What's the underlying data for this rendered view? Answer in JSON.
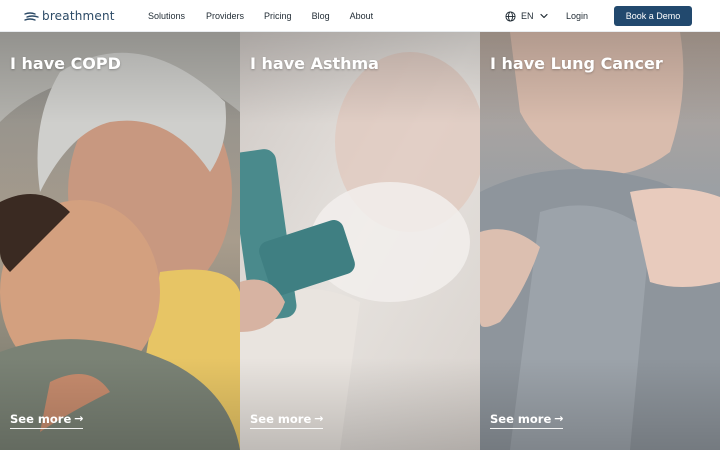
{
  "brand": {
    "name": "breathment",
    "color": "#22496e"
  },
  "nav": {
    "items": [
      {
        "label": "Solutions"
      },
      {
        "label": "Providers"
      },
      {
        "label": "Pricing"
      },
      {
        "label": "Blog"
      },
      {
        "label": "About"
      }
    ]
  },
  "language": {
    "label": "EN",
    "icon": "globe-icon"
  },
  "login": {
    "label": "Login"
  },
  "cta": {
    "label": "Book a Demo",
    "color": "#22496e"
  },
  "cards": [
    {
      "title": "I have COPD",
      "link": "See more"
    },
    {
      "title": "I have Asthma",
      "link": "See more"
    },
    {
      "title": "I have Lung Cancer",
      "link": "See more"
    }
  ]
}
